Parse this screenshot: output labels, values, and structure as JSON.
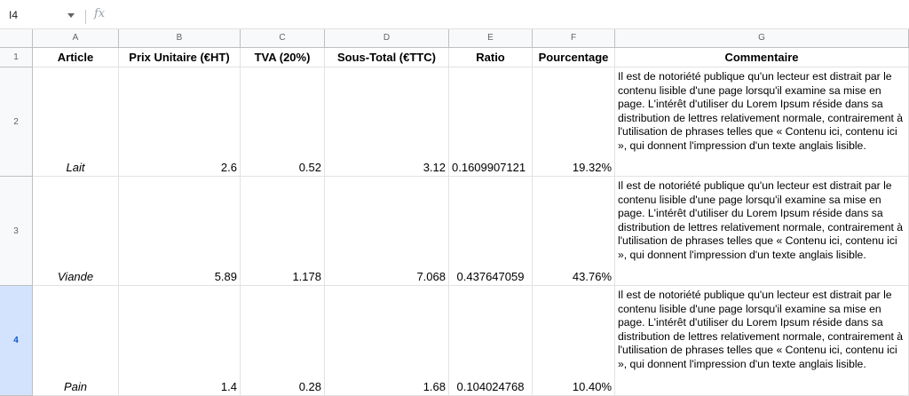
{
  "formula_bar": {
    "cell_ref": "I4",
    "fx_label": "fx"
  },
  "columns": [
    "A",
    "B",
    "C",
    "D",
    "E",
    "F",
    "G"
  ],
  "header_row": {
    "row_number": "1",
    "labels": [
      "Article",
      "Prix Unitaire (€HT)",
      "TVA (20%)",
      "Sous-Total (€TTC)",
      "Ratio",
      "Pourcentage",
      "Commentaire"
    ]
  },
  "rows": [
    {
      "row_number": "2",
      "article": "Lait",
      "prix": "2.6",
      "tva": "0.52",
      "sous_total": "3.12",
      "ratio": "0.1609907121",
      "pourcentage": "19.32%",
      "commentaire": "Il est de notoriété publique qu'un lecteur est distrait par le contenu lisible d'une page lorsqu'il examine sa mise en page. L'intérêt d'utiliser du Lorem Ipsum réside dans sa distribution de lettres relativement normale, contrairement à l'utilisation de phrases telles que « Contenu ici, contenu ici », qui donnent l'impression d'un texte anglais lisible."
    },
    {
      "row_number": "3",
      "article": "Viande",
      "prix": "5.89",
      "tva": "1.178",
      "sous_total": "7.068",
      "ratio": "0.437647059",
      "pourcentage": "43.76%",
      "commentaire": "Il est de notoriété publique qu'un lecteur est distrait par le contenu lisible d'une page lorsqu'il examine sa mise en page. L'intérêt d'utiliser du Lorem Ipsum réside dans sa distribution de lettres relativement normale, contrairement à l'utilisation de phrases telles que « Contenu ici, contenu ici », qui donnent l'impression d'un texte anglais lisible."
    },
    {
      "row_number": "4",
      "article": "Pain",
      "prix": "1.4",
      "tva": "0.28",
      "sous_total": "1.68",
      "ratio": "0.104024768",
      "pourcentage": "10.40%",
      "commentaire": "Il est de notoriété publique qu'un lecteur est distrait par le contenu lisible d'une page lorsqu'il examine sa mise en page. L'intérêt d'utiliser du Lorem Ipsum réside dans sa distribution de lettres relativement normale, contrairement à l'utilisation de phrases telles que « Contenu ici, contenu ici », qui donnent l'impression d'un texte anglais lisible."
    }
  ],
  "colors": {
    "selected_row_header": "#d3e3fd",
    "selected_row_text": "#0b57d0",
    "grid_line": "#e2e2e2",
    "header_bg": "#f8f9fa"
  }
}
